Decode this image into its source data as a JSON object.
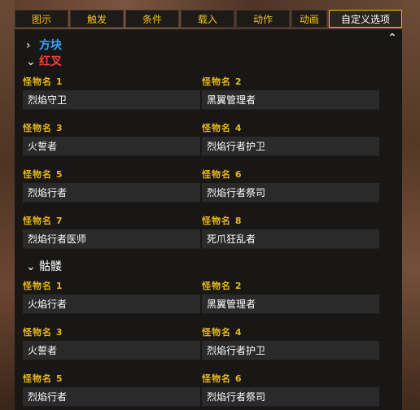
{
  "tabs": [
    {
      "label": "图示"
    },
    {
      "label": "触发"
    },
    {
      "label": "条件"
    },
    {
      "label": "载入"
    },
    {
      "label": "动作"
    },
    {
      "label": "动画"
    },
    {
      "label": "自定义选项",
      "active": true
    }
  ],
  "groups": {
    "fangkuai": {
      "label": "方块",
      "collapsed": true,
      "color": "#3fa0ff"
    },
    "hongcha": {
      "label": "红叉",
      "collapsed": false,
      "color": "#ff3b3b",
      "fields": [
        {
          "label": "怪物名 1",
          "value": "烈焰守卫"
        },
        {
          "label": "怪物名 2",
          "value": "黑翼管理者"
        },
        {
          "label": "怪物名 3",
          "value": "火誓者"
        },
        {
          "label": "怪物名 4",
          "value": "烈焰行者护卫"
        },
        {
          "label": "怪物名 5",
          "value": "烈焰行者"
        },
        {
          "label": "怪物名 6",
          "value": "烈焰行者祭司"
        },
        {
          "label": "怪物名 7",
          "value": "烈焰行者医师"
        },
        {
          "label": "怪物名 8",
          "value": "死爪狂乱者"
        }
      ]
    },
    "kulou": {
      "label": "骷髅",
      "collapsed": false,
      "color": "#ffffff",
      "fields": [
        {
          "label": "怪物名 1",
          "value": "火焰行者"
        },
        {
          "label": "怪物名 2",
          "value": "黑翼管理者"
        },
        {
          "label": "怪物名 3",
          "value": "火誓者"
        },
        {
          "label": "怪物名 4",
          "value": "烈焰行者护卫"
        },
        {
          "label": "怪物名 5",
          "value": "烈焰行者"
        },
        {
          "label": "怪物名 6",
          "value": "烈焰行者祭司"
        }
      ]
    }
  },
  "colors": {
    "label_gold": "#e9b81c",
    "tab_text": "#f3c21b",
    "active_border": "#f0c020"
  }
}
